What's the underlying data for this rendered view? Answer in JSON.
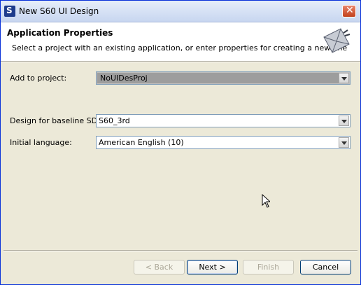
{
  "window": {
    "title": "New S60 UI Design"
  },
  "header": {
    "title": "Application Properties",
    "description": "Select a project with an existing application, or enter properties for creating a new one"
  },
  "form": {
    "add_to_project": {
      "label": "Add to project:",
      "value": "NoUIDesProj"
    },
    "baseline_sdk": {
      "label": "Design for baseline SDK:",
      "value": "S60_3rd"
    },
    "initial_language": {
      "label": "Initial language:",
      "value": "American English (10)"
    }
  },
  "buttons": {
    "back": "< Back",
    "next": "Next >",
    "finish": "Finish",
    "cancel": "Cancel"
  }
}
